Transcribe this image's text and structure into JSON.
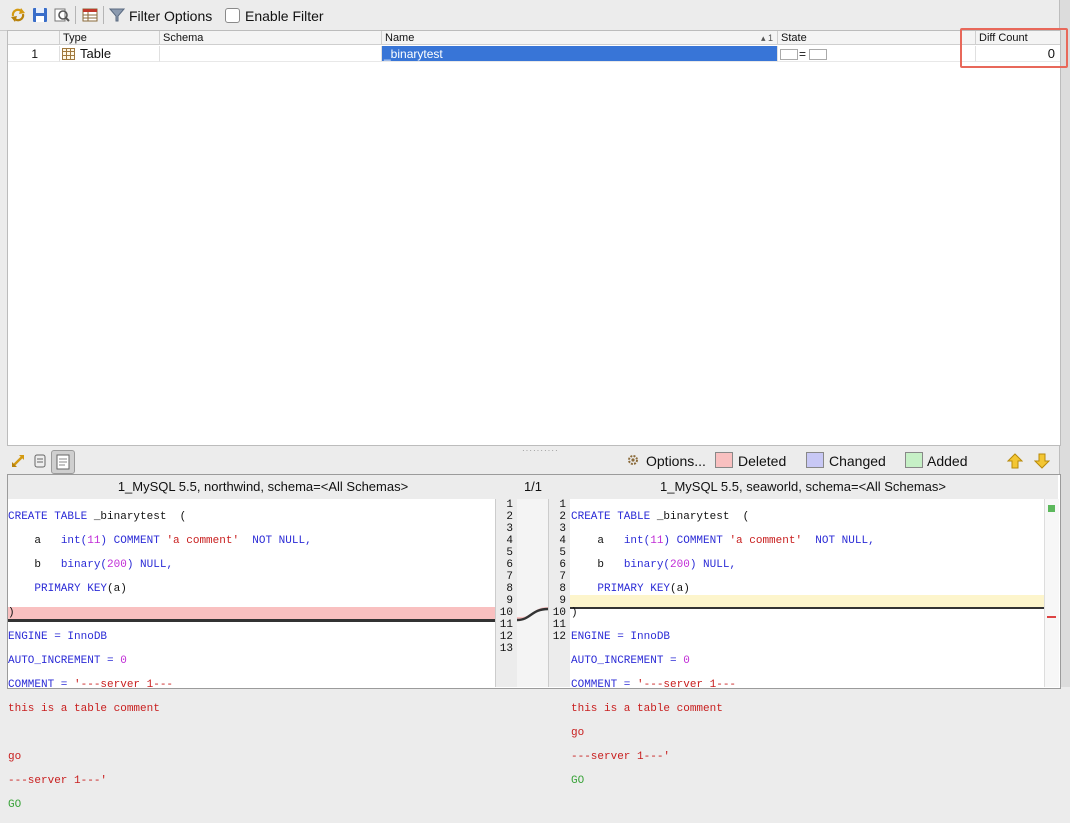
{
  "toolbar": {
    "filter_options_label": "Filter Options",
    "enable_filter_label": "Enable Filter"
  },
  "grid": {
    "columns": [
      "Type",
      "Schema",
      "Name",
      "State",
      "Diff Count"
    ],
    "sort_indicator": "▴ 1",
    "rows": [
      {
        "index": "1",
        "type": "Table",
        "schema": "",
        "name": "_binarytest",
        "state_symbol": "=",
        "diff_count": "0"
      }
    ]
  },
  "bottom_toolbar": {
    "options_label": "Options...",
    "legend": [
      {
        "label": "Deleted",
        "color": "#f9c0c0"
      },
      {
        "label": "Changed",
        "color": "#c8c8f5"
      },
      {
        "label": "Added",
        "color": "#c6f0c6"
      }
    ]
  },
  "diff": {
    "left_title": "1_MySQL 5.5, northwind,  schema=<All Schemas>",
    "right_title": "1_MySQL 5.5, seaworld,  schema=<All Schemas>",
    "counter": "1/1",
    "left_line_numbers": [
      "1",
      "2",
      "3",
      "4",
      "5",
      "6",
      "7",
      "8",
      "9",
      "10",
      "11",
      "12",
      "13"
    ],
    "right_line_numbers": [
      "1",
      "2",
      "3",
      "4",
      "5",
      "6",
      "7",
      "8",
      "9",
      "10",
      "11",
      "12"
    ],
    "left_lines": [
      "CREATE TABLE _binarytest  (",
      "    a   int(11) COMMENT 'a comment'  NOT NULL,",
      "    b   binary(200) NULL,",
      "    PRIMARY KEY(a)",
      ")",
      "ENGINE = InnoDB",
      "AUTO_INCREMENT = 0",
      "COMMENT = '---server 1---",
      "this is a table comment",
      "",
      "go",
      "---server 1---'",
      "GO"
    ],
    "right_lines": [
      "CREATE TABLE _binarytest  (",
      "    a   int(11) COMMENT 'a comment'  NOT NULL,",
      "    b   binary(200) NULL,",
      "    PRIMARY KEY(a)",
      ")",
      "ENGINE = InnoDB",
      "AUTO_INCREMENT = 0",
      "COMMENT = '---server 1---",
      "this is a table comment",
      "go",
      "---server 1---'",
      "GO"
    ],
    "deleted_color": "#f9c0c0",
    "changed_color": "#fdf5cc"
  }
}
